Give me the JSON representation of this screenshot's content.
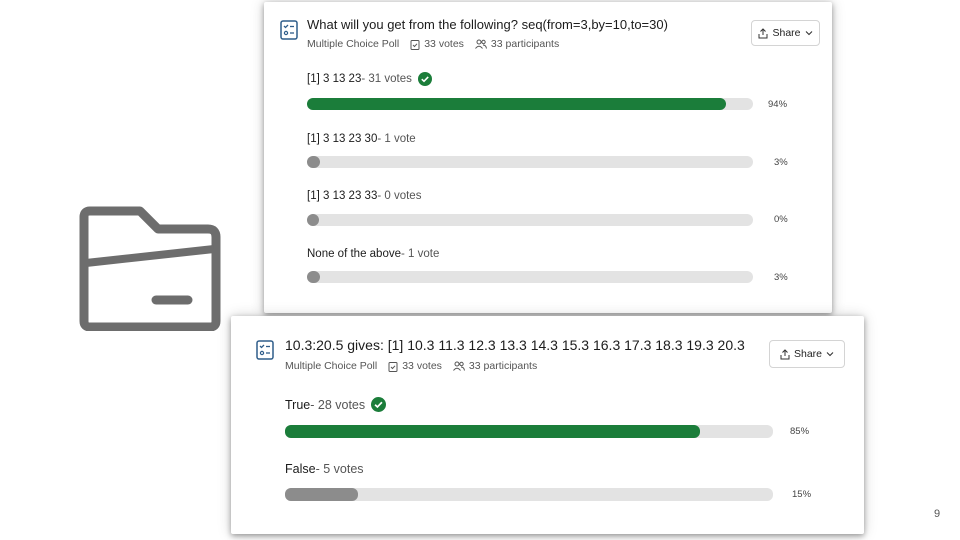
{
  "folder_icon": "folder-icon",
  "page_number": "9",
  "polls": [
    {
      "title": "What will you get from the following? seq(from=3,by=10,to=30)",
      "type": "Multiple Choice Poll",
      "votes": "33 votes",
      "participants": "33 participants",
      "share_label": "Share",
      "options": [
        {
          "label": "[1] 3 13 23",
          "count": " - 31 votes",
          "percent_text": "94%",
          "fraction": 0.94,
          "correct": true
        },
        {
          "label": "[1] 3 13 23 30",
          "count": " - 1 vote",
          "percent_text": "3%",
          "fraction": 0.03,
          "correct": false
        },
        {
          "label": "[1] 3 13 23 33",
          "count": " - 0 votes",
          "percent_text": "0%",
          "fraction": 0.0,
          "correct": false
        },
        {
          "label": "None of the above",
          "count": " - 1 vote",
          "percent_text": "3%",
          "fraction": 0.03,
          "correct": false
        }
      ]
    },
    {
      "title": "10.3:20.5 gives: [1] 10.3 11.3 12.3 13.3 14.3 15.3 16.3 17.3 18.3 19.3 20.3",
      "type": "Multiple Choice Poll",
      "votes": "33 votes",
      "participants": "33 participants",
      "share_label": "Share",
      "options": [
        {
          "label": "True",
          "count": " - 28 votes",
          "percent_text": "85%",
          "fraction": 0.85,
          "correct": true
        },
        {
          "label": "False",
          "count": " - 5 votes",
          "percent_text": "15%",
          "fraction": 0.15,
          "correct": false
        }
      ]
    }
  ],
  "colors": {
    "correct": "#1b7d3a",
    "other": "#8c8c8c",
    "track": "#e3e3e3",
    "icon": "#2f5d8a"
  }
}
